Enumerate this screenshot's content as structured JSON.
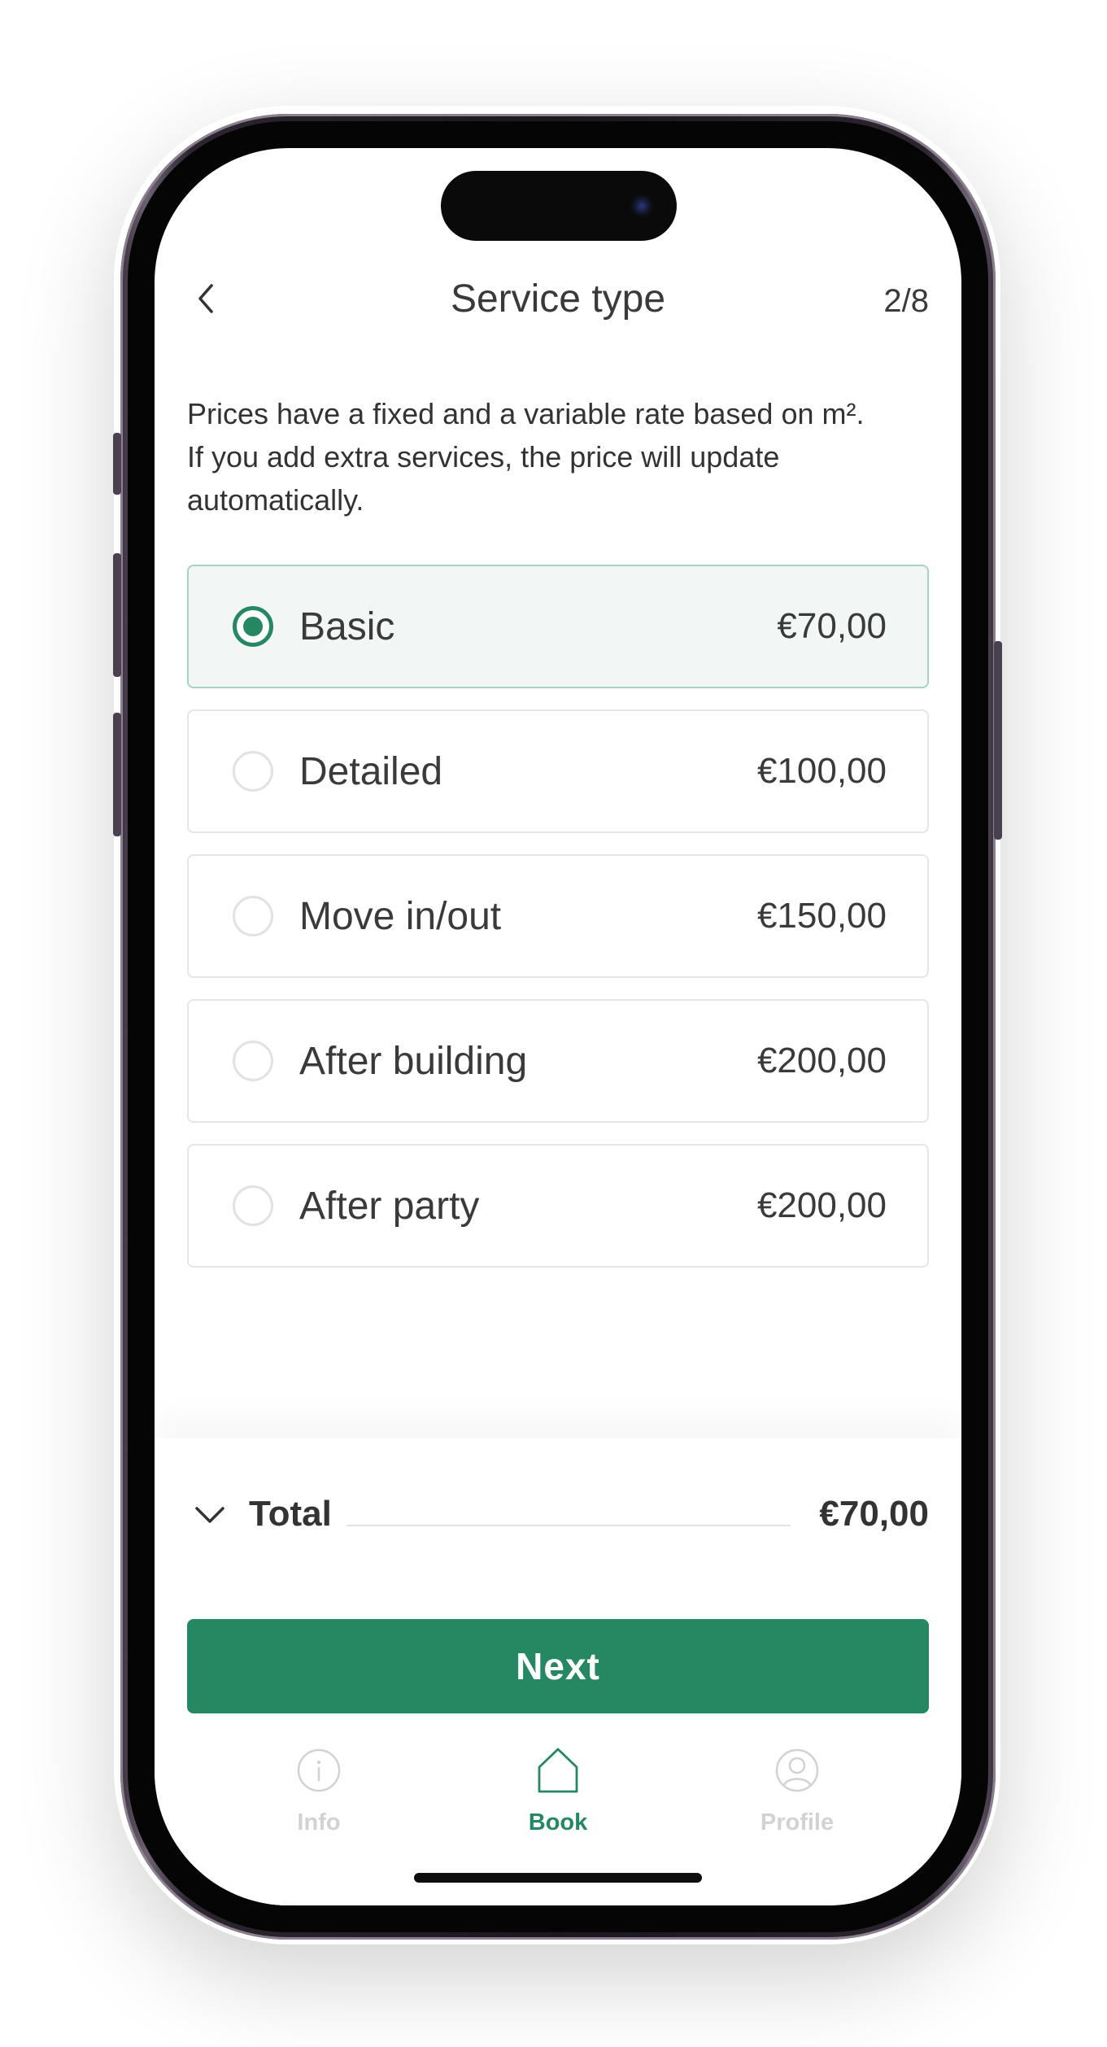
{
  "header": {
    "title": "Service type",
    "step": "2/8"
  },
  "intro": {
    "line1": "Prices have a fixed and a variable rate based on m².",
    "line2": "If you add extra services, the price will update",
    "line3": "automatically."
  },
  "options": [
    {
      "label": "Basic",
      "price": "€70,00",
      "selected": true
    },
    {
      "label": "Detailed",
      "price": "€100,00",
      "selected": false
    },
    {
      "label": "Move in/out",
      "price": "€150,00",
      "selected": false
    },
    {
      "label": "After building",
      "price": "€200,00",
      "selected": false
    },
    {
      "label": "After party",
      "price": "€200,00",
      "selected": false
    }
  ],
  "summary": {
    "total_label": "Total",
    "total_value": "€70,00"
  },
  "next_label": "Next",
  "tabs": [
    {
      "label": "Info",
      "icon": "info-icon",
      "active": false
    },
    {
      "label": "Book",
      "icon": "home-icon",
      "active": true
    },
    {
      "label": "Profile",
      "icon": "profile-icon",
      "active": false
    }
  ],
  "colors": {
    "accent": "#268763",
    "selected_bg": "#f2f7f5",
    "selected_border": "#a9d2c2",
    "text": "#333333",
    "inactive_tab": "#d2d2d2"
  }
}
